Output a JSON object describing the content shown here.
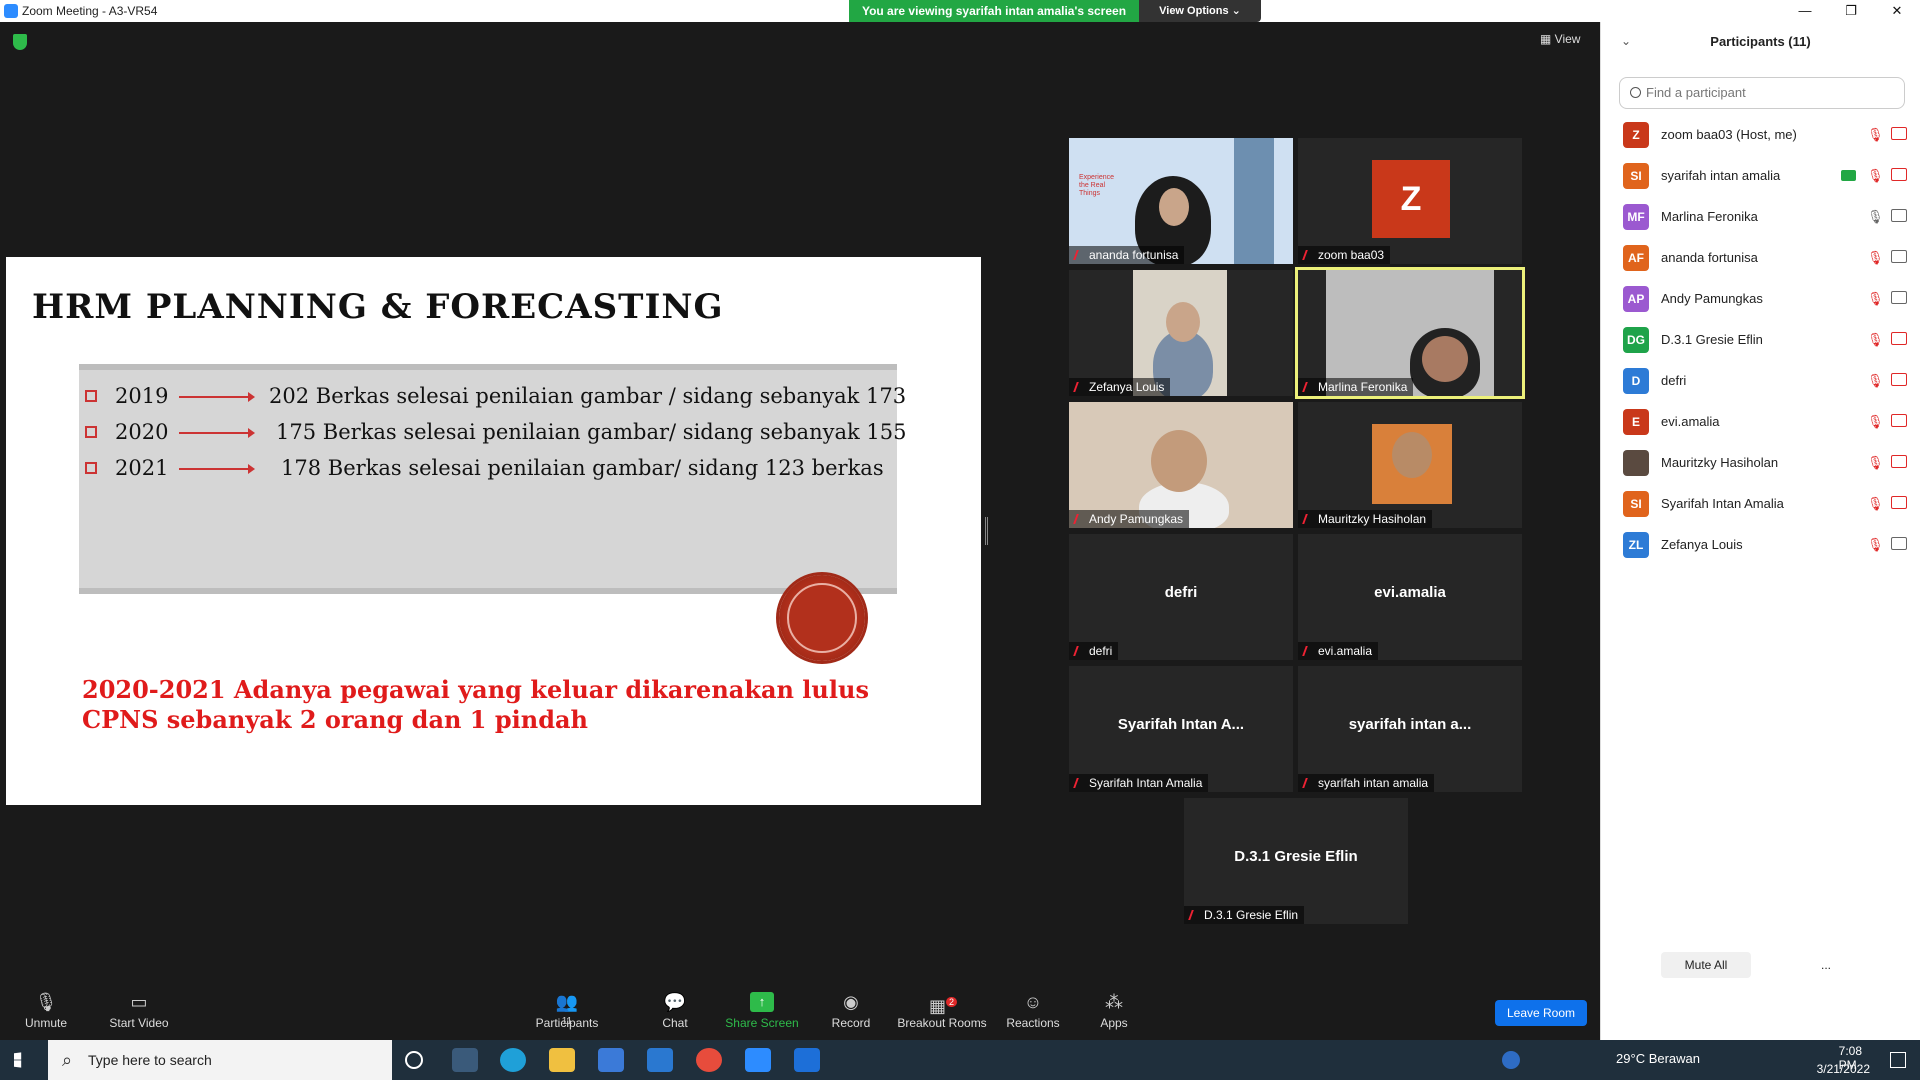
{
  "window": {
    "title": "Zoom Meeting - A3-VR54",
    "min": "—",
    "max": "❐",
    "close": "✕"
  },
  "banner": {
    "viewing": "You are viewing syarifah intan amalia's screen",
    "view_options": "View Options ⌄"
  },
  "view_button": "▦ View",
  "slide": {
    "title": "HRM PLANNING & FORECASTING",
    "rows": [
      {
        "year": "2019",
        "text": "202 Berkas selesai penilaian gambar / sidang sebanyak 173"
      },
      {
        "year": "2020",
        "text": "175 Berkas selesai penilaian gambar/ sidang sebanyak 155"
      },
      {
        "year": "2021",
        "text": "178 Berkas selesai penilaian gambar/ sidang 123 berkas"
      }
    ],
    "note_line1": "2020-2021 Adanya pegawai yang keluar dikarenakan lulus",
    "note_line2": "CPNS sebanyak 2 orang  dan 1 pindah"
  },
  "tiles": {
    "t1": {
      "caption": "ananda fortunisa",
      "brand_lines": [
        "Experience",
        "the Real",
        "Things"
      ]
    },
    "t2": {
      "caption": "zoom baa03",
      "initial": "Z"
    },
    "t3": {
      "caption": "Zefanya Louis"
    },
    "t4": {
      "caption": "Marlina Feronika"
    },
    "t5": {
      "caption": "Andy Pamungkas"
    },
    "t6": {
      "caption": "Mauritzky Hasiholan"
    },
    "t7": {
      "caption": "defri",
      "name": "defri"
    },
    "t8": {
      "caption": "evi.amalia",
      "name": "evi.amalia"
    },
    "t9": {
      "caption": "Syarifah Intan Amalia",
      "name": "Syarifah Intan A..."
    },
    "t10": {
      "caption": "syarifah intan amalia",
      "name": "syarifah intan a..."
    },
    "t11": {
      "caption": "D.3.1 Gresie Eflin",
      "name": "D.3.1 Gresie Eflin"
    }
  },
  "toolbar": {
    "unmute": "Unmute",
    "start_video": "Start Video",
    "participants": "Participants",
    "participants_count": "11",
    "chat": "Chat",
    "share": "Share Screen",
    "record": "Record",
    "breakout": "Breakout Rooms",
    "breakout_badge": "2",
    "reactions": "Reactions",
    "apps": "Apps",
    "leave": "Leave Room"
  },
  "panel": {
    "title": "Participants (11)",
    "search_placeholder": "Find a participant",
    "mute_all": "Mute All",
    "more": "...",
    "participants": [
      {
        "initials": "Z",
        "name": "zoom baa03 (Host, me)",
        "color": "#c9381a"
      },
      {
        "initials": "SI",
        "name": "syarifah intan amalia",
        "color": "#e0641c"
      },
      {
        "initials": "MF",
        "name": "Marlina Feronika",
        "color": "#9b59d0"
      },
      {
        "initials": "AF",
        "name": "ananda fortunisa",
        "color": "#e0641c"
      },
      {
        "initials": "AP",
        "name": "Andy Pamungkas",
        "color": "#9b59d0"
      },
      {
        "initials": "DG",
        "name": "D.3.1 Gresie Eflin",
        "color": "#1fa34a"
      },
      {
        "initials": "D",
        "name": "defri",
        "color": "#2d7bd6"
      },
      {
        "initials": "E",
        "name": "evi.amalia",
        "color": "#c9381a"
      },
      {
        "initials": "",
        "name": "Mauritzky Hasiholan",
        "color": "#5a4a40"
      },
      {
        "initials": "SI",
        "name": "Syarifah Intan Amalia",
        "color": "#e0641c"
      },
      {
        "initials": "ZL",
        "name": "Zefanya Louis",
        "color": "#2d7bd6"
      }
    ]
  },
  "taskbar": {
    "search": "Type here to search",
    "weather": "29°C  Berawan",
    "time": "7:08 PM",
    "date": "3/21/2022"
  }
}
